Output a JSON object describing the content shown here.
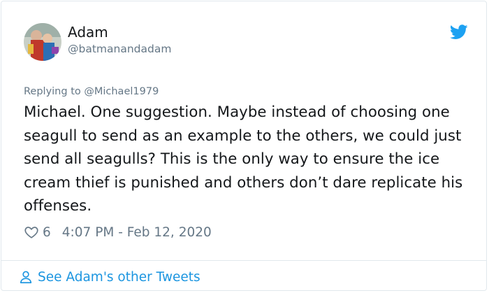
{
  "user": {
    "name": "Adam",
    "handle": "@batmanandadam"
  },
  "tweet": {
    "reply_prefix": "Replying to ",
    "reply_to": "@Michael1979",
    "text": "Michael. One suggestion. Maybe instead of choosing one seagull to send as an example to the others, we could just send all seagulls? This is the only way to ensure the ice cream thief is punished and others don’t dare replicate his offenses.",
    "likes": "6",
    "timestamp": "4:07 PM - Feb 12, 2020"
  },
  "footer": {
    "link_label": "See Adam's other Tweets"
  },
  "icons": {
    "brand": "twitter-bird-icon",
    "like": "heart-icon",
    "profile": "person-icon"
  },
  "colors": {
    "brand_blue": "#1da1f2",
    "link_blue": "#1b95e0",
    "secondary_text": "#657786",
    "border": "#e1e8ed"
  }
}
